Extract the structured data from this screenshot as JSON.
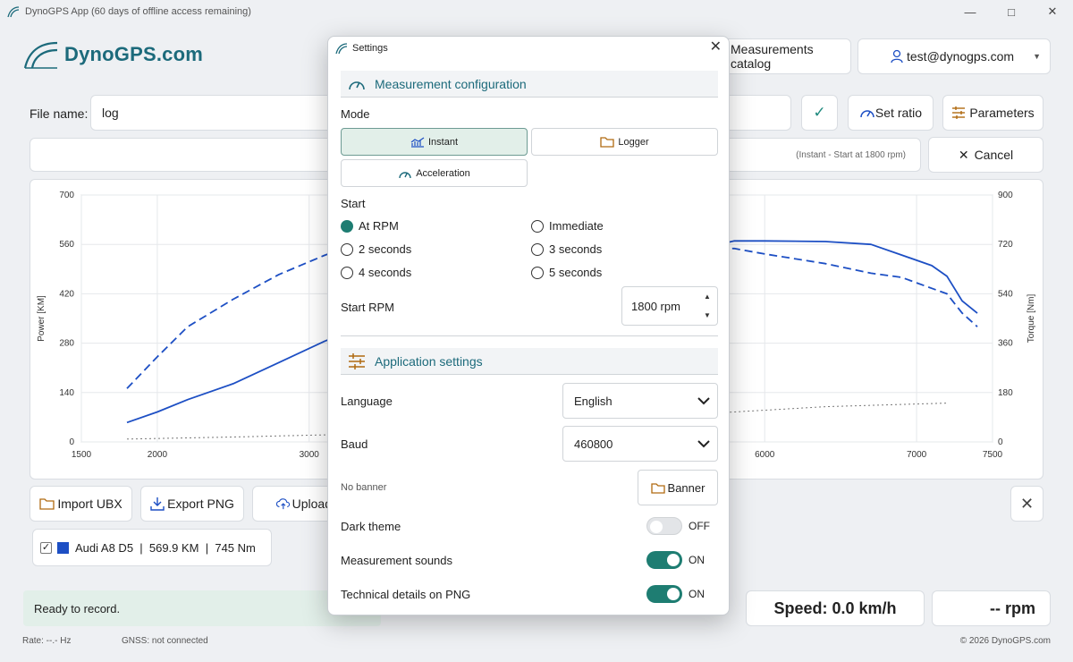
{
  "window": {
    "title": "DynoGPS App (60 days of offline access remaining)"
  },
  "header": {
    "brand": "DynoGPS.com",
    "catalog_label": "Measurements catalog",
    "user_label": "test@dynogps.com"
  },
  "file": {
    "label": "File name:",
    "value": "log"
  },
  "toolbar": {
    "set_ratio_label": "Set ratio",
    "parameters_label": "Parameters",
    "status_hint": "(Instant - Start at 1800 rpm)",
    "cancel_label": "Cancel"
  },
  "actions": {
    "import_label": "Import UBX",
    "export_label": "Export PNG",
    "upload_label": "Upload"
  },
  "legend": {
    "entry": "Audi A8 D5  |  569.9 KM  |  745 Nm",
    "color": "#1d4fc4",
    "checked": true
  },
  "status": {
    "ready": "Ready to record.",
    "speed": "Speed: 0.0 km/h",
    "rpm": "-- rpm",
    "rate": "Rate: --.- Hz",
    "gnss": "GNSS: not connected",
    "copyright": "© 2026 DynoGPS.com"
  },
  "settings": {
    "title": "Settings",
    "measurement_section": "Measurement configuration",
    "mode_label": "Mode",
    "modes": [
      {
        "label": "Instant",
        "active": true
      },
      {
        "label": "Logger",
        "active": false
      },
      {
        "label": "Acceleration",
        "active": false
      }
    ],
    "start_label": "Start",
    "start_options": [
      {
        "label": "At RPM",
        "checked": true
      },
      {
        "label": "Immediate",
        "checked": false
      },
      {
        "label": "2 seconds",
        "checked": false
      },
      {
        "label": "3 seconds",
        "checked": false
      },
      {
        "label": "4 seconds",
        "checked": false
      },
      {
        "label": "5 seconds",
        "checked": false
      }
    ],
    "start_rpm_label": "Start RPM",
    "start_rpm_value": "1800 rpm",
    "app_section": "Application settings",
    "language_label": "Language",
    "language_value": "English",
    "baud_label": "Baud",
    "baud_value": "460800",
    "no_banner": "No banner",
    "banner_button": "Banner",
    "dark_theme_label": "Dark theme",
    "dark_theme_state": "OFF",
    "sounds_label": "Measurement sounds",
    "sounds_state": "ON",
    "tech_label": "Technical details on PNG",
    "tech_state": "ON"
  },
  "colors": {
    "accent": "#1e7d72",
    "brand": "#1c6a7b",
    "series": "#1d4fc4"
  },
  "chart_data": {
    "type": "line",
    "xlabel": "",
    "ylabel_left": "Power [KM]",
    "ylabel_right": "Torque [Nm]",
    "xlim": [
      1500,
      7500
    ],
    "ylim_left": [
      0,
      700
    ],
    "ylim_right": [
      0,
      900
    ],
    "x_ticks": [
      "1500",
      "2000",
      "3000",
      "6000",
      "7000",
      "7500"
    ],
    "y_left_ticks": [
      "0",
      "140",
      "280",
      "420",
      "560",
      "700"
    ],
    "y_right_ticks": [
      "0",
      "180",
      "360",
      "540",
      "720",
      "900"
    ],
    "grid": true,
    "series": [
      {
        "axis": "left",
        "style": "solid",
        "x": [
          1800,
          2000,
          2200,
          2500,
          2800,
          3100,
          3300,
          5800,
          6000,
          6400,
          6700,
          6900,
          7100,
          7200,
          7300,
          7400
        ],
        "y": [
          55,
          85,
          120,
          165,
          225,
          285,
          320,
          570,
          570,
          568,
          560,
          530,
          500,
          470,
          400,
          365
        ]
      },
      {
        "axis": "right",
        "style": "dashed",
        "x": [
          1800,
          2000,
          2200,
          2500,
          2800,
          3100,
          3300,
          5800,
          6000,
          6400,
          6700,
          6900,
          7100,
          7200,
          7300,
          7400
        ],
        "y": [
          195,
          310,
          420,
          520,
          610,
          680,
          722,
          705,
          685,
          650,
          615,
          600,
          560,
          540,
          470,
          420
        ]
      },
      {
        "axis": "left",
        "style": "dotted",
        "x": [
          1800,
          2500,
          3300,
          5800,
          6400,
          7200
        ],
        "y": [
          8,
          14,
          22,
          85,
          100,
          110
        ]
      }
    ]
  }
}
